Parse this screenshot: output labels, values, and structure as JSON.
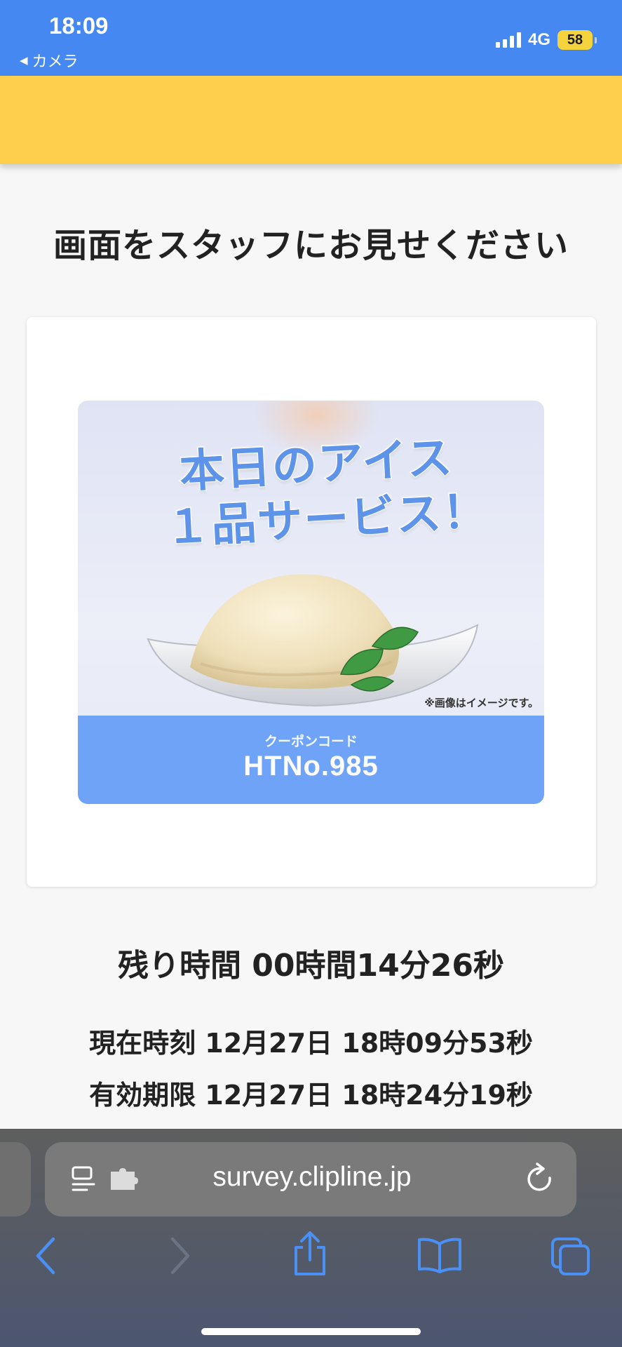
{
  "status_bar": {
    "time": "18:09",
    "back_app": "カメラ",
    "network": "4G",
    "battery": "58",
    "colors": {
      "background": "#4688f1",
      "battery": "#f5d33f"
    }
  },
  "header": {
    "color": "#fdcf4d"
  },
  "main": {
    "title": "画面をスタッフにお見せください",
    "coupon": {
      "headline_line1": "本日のアイス",
      "headline_line2": "１品サービス！",
      "image_note": "※画像はイメージです。",
      "code_label": "クーポンコード",
      "code": "HTNo.985",
      "accent_color": "#6ea3f7"
    },
    "remaining_time": "残り時間 00時間14分26秒",
    "current_time": "現在時刻 12月27日 18時09分53秒",
    "expiry": "有効期限 12月27日 18時24分19秒"
  },
  "browser": {
    "url": "survey.clipline.jp",
    "address_icons": [
      "page-format-icon",
      "extension-icon"
    ],
    "toolbar_icons": [
      "back-icon",
      "forward-icon",
      "share-icon",
      "bookmarks-icon",
      "tabs-icon"
    ]
  }
}
